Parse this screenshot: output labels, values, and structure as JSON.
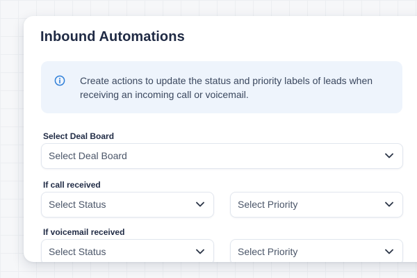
{
  "panel": {
    "title": "Inbound Automations",
    "info": {
      "icon": "info-circle-icon",
      "text": "Create actions to update the status and priority labels of leads when receiving an incoming call or voicemail."
    }
  },
  "deal_board": {
    "label": "Select Deal Board",
    "placeholder": "Select Deal Board"
  },
  "call_received": {
    "label": "If call received",
    "status_placeholder": "Select Status",
    "priority_placeholder": "Select Priority"
  },
  "voicemail_received": {
    "label": "If voicemail received",
    "status_placeholder": "Select Status",
    "priority_placeholder": "Select Priority"
  },
  "colors": {
    "info_background": "#eef4fc",
    "info_icon": "#2f7fd8",
    "heading": "#1f2a44",
    "chevron": "#2d3748"
  }
}
